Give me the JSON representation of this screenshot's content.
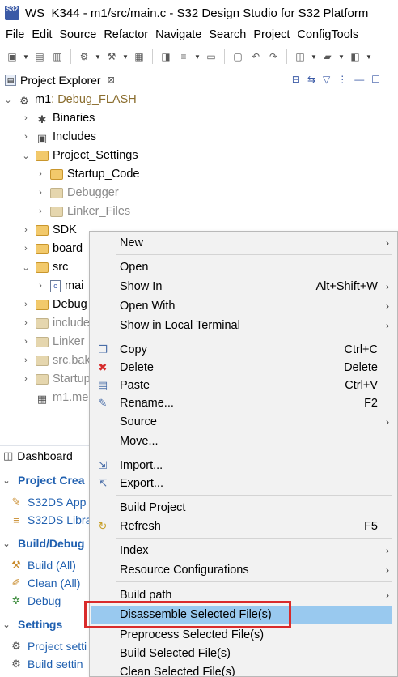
{
  "window": {
    "title": "WS_K344 - m1/src/main.c - S32 Design Studio for S32 Platform",
    "app_icon_text": "S32"
  },
  "menubar": [
    "File",
    "Edit",
    "Source",
    "Refactor",
    "Navigate",
    "Search",
    "Project",
    "ConfigTools"
  ],
  "project_explorer": {
    "tab_label": "Project Explorer",
    "close_symbol": "⊠",
    "tree": [
      {
        "label": "m1",
        "suffix": ": Debug_FLASH",
        "icon": "project-icon",
        "arrow": "⌄"
      },
      {
        "label": "Binaries",
        "icon": "binaries-icon",
        "arrow": "›"
      },
      {
        "label": "Includes",
        "icon": "includes-icon",
        "arrow": "›"
      },
      {
        "label": "Project_Settings",
        "icon": "folder-icon",
        "arrow": "⌄"
      },
      {
        "label": "Startup_Code",
        "icon": "folder-icon",
        "arrow": "›"
      },
      {
        "label": "Debugger",
        "icon": "folder-icon",
        "arrow": "›"
      },
      {
        "label": "Linker_Files",
        "icon": "folder-icon",
        "arrow": "›"
      },
      {
        "label": "SDK",
        "icon": "folder-icon",
        "arrow": "›"
      },
      {
        "label": "board",
        "icon": "folder-icon",
        "arrow": "›"
      },
      {
        "label": "src",
        "icon": "folder-icon",
        "arrow": "⌄"
      },
      {
        "label": "mai",
        "icon": "c-file-icon",
        "arrow": "›"
      },
      {
        "label": "Debug",
        "icon": "folder-icon",
        "arrow": "›"
      },
      {
        "label": "include",
        "icon": "folder-icon",
        "arrow": "›"
      },
      {
        "label": "Linker_",
        "icon": "folder-icon",
        "arrow": "›"
      },
      {
        "label": "src.bak",
        "icon": "folder-icon",
        "arrow": "›"
      },
      {
        "label": "Startup",
        "icon": "folder-icon",
        "arrow": "›"
      },
      {
        "label": "m1.me",
        "icon": "file-icon",
        "arrow": ""
      }
    ]
  },
  "dashboard": {
    "tab_label": "Dashboard",
    "sections": [
      {
        "title": "Project Crea",
        "items": [
          "S32DS App",
          "S32DS Libra"
        ]
      },
      {
        "title": "Build/Debug",
        "items": [
          "Build  (All)",
          "Clean  (All)",
          "Debug"
        ]
      },
      {
        "title": "Settings",
        "items": [
          "Project setti",
          "Build settin"
        ]
      }
    ]
  },
  "context_menu": {
    "items": [
      {
        "label": "New",
        "shortcut": "",
        "submenu": true,
        "icon": ""
      },
      {
        "label": "Open",
        "shortcut": "",
        "submenu": false,
        "icon": ""
      },
      {
        "label": "Show In",
        "shortcut": "Alt+Shift+W",
        "submenu": true,
        "icon": ""
      },
      {
        "label": "Open With",
        "shortcut": "",
        "submenu": true,
        "icon": ""
      },
      {
        "label": "Show in Local Terminal",
        "shortcut": "",
        "submenu": true,
        "icon": ""
      },
      {
        "label": "Copy",
        "shortcut": "Ctrl+C",
        "submenu": false,
        "icon": "copy-icon"
      },
      {
        "label": "Delete",
        "shortcut": "Delete",
        "submenu": false,
        "icon": "delete-icon"
      },
      {
        "label": "Paste",
        "shortcut": "Ctrl+V",
        "submenu": false,
        "icon": "paste-icon"
      },
      {
        "label": "Rename...",
        "shortcut": "F2",
        "submenu": false,
        "icon": "rename-icon"
      },
      {
        "label": "Source",
        "shortcut": "",
        "submenu": true,
        "icon": ""
      },
      {
        "label": "Move...",
        "shortcut": "",
        "submenu": false,
        "icon": ""
      },
      {
        "label": "Import...",
        "shortcut": "",
        "submenu": false,
        "icon": "import-icon"
      },
      {
        "label": "Export...",
        "shortcut": "",
        "submenu": false,
        "icon": "export-icon"
      },
      {
        "label": "Build Project",
        "shortcut": "",
        "submenu": false,
        "icon": ""
      },
      {
        "label": "Refresh",
        "shortcut": "F5",
        "submenu": false,
        "icon": "refresh-icon"
      },
      {
        "label": "Index",
        "shortcut": "",
        "submenu": true,
        "icon": ""
      },
      {
        "label": "Resource Configurations",
        "shortcut": "",
        "submenu": true,
        "icon": ""
      },
      {
        "label": "Build path",
        "shortcut": "",
        "submenu": true,
        "icon": ""
      },
      {
        "label": "Disassemble Selected File(s)",
        "shortcut": "",
        "submenu": false,
        "icon": "",
        "highlighted": true
      },
      {
        "label": "Preprocess Selected File(s)",
        "shortcut": "",
        "submenu": false,
        "icon": ""
      },
      {
        "label": "Build Selected File(s)",
        "shortcut": "",
        "submenu": false,
        "icon": ""
      },
      {
        "label": "Clean Selected File(s)",
        "shortcut": "",
        "submenu": false,
        "icon": ""
      }
    ]
  },
  "colors": {
    "highlight": "#99c9ef",
    "annotation_box": "#d92b2b",
    "link_blue": "#2060b0"
  }
}
